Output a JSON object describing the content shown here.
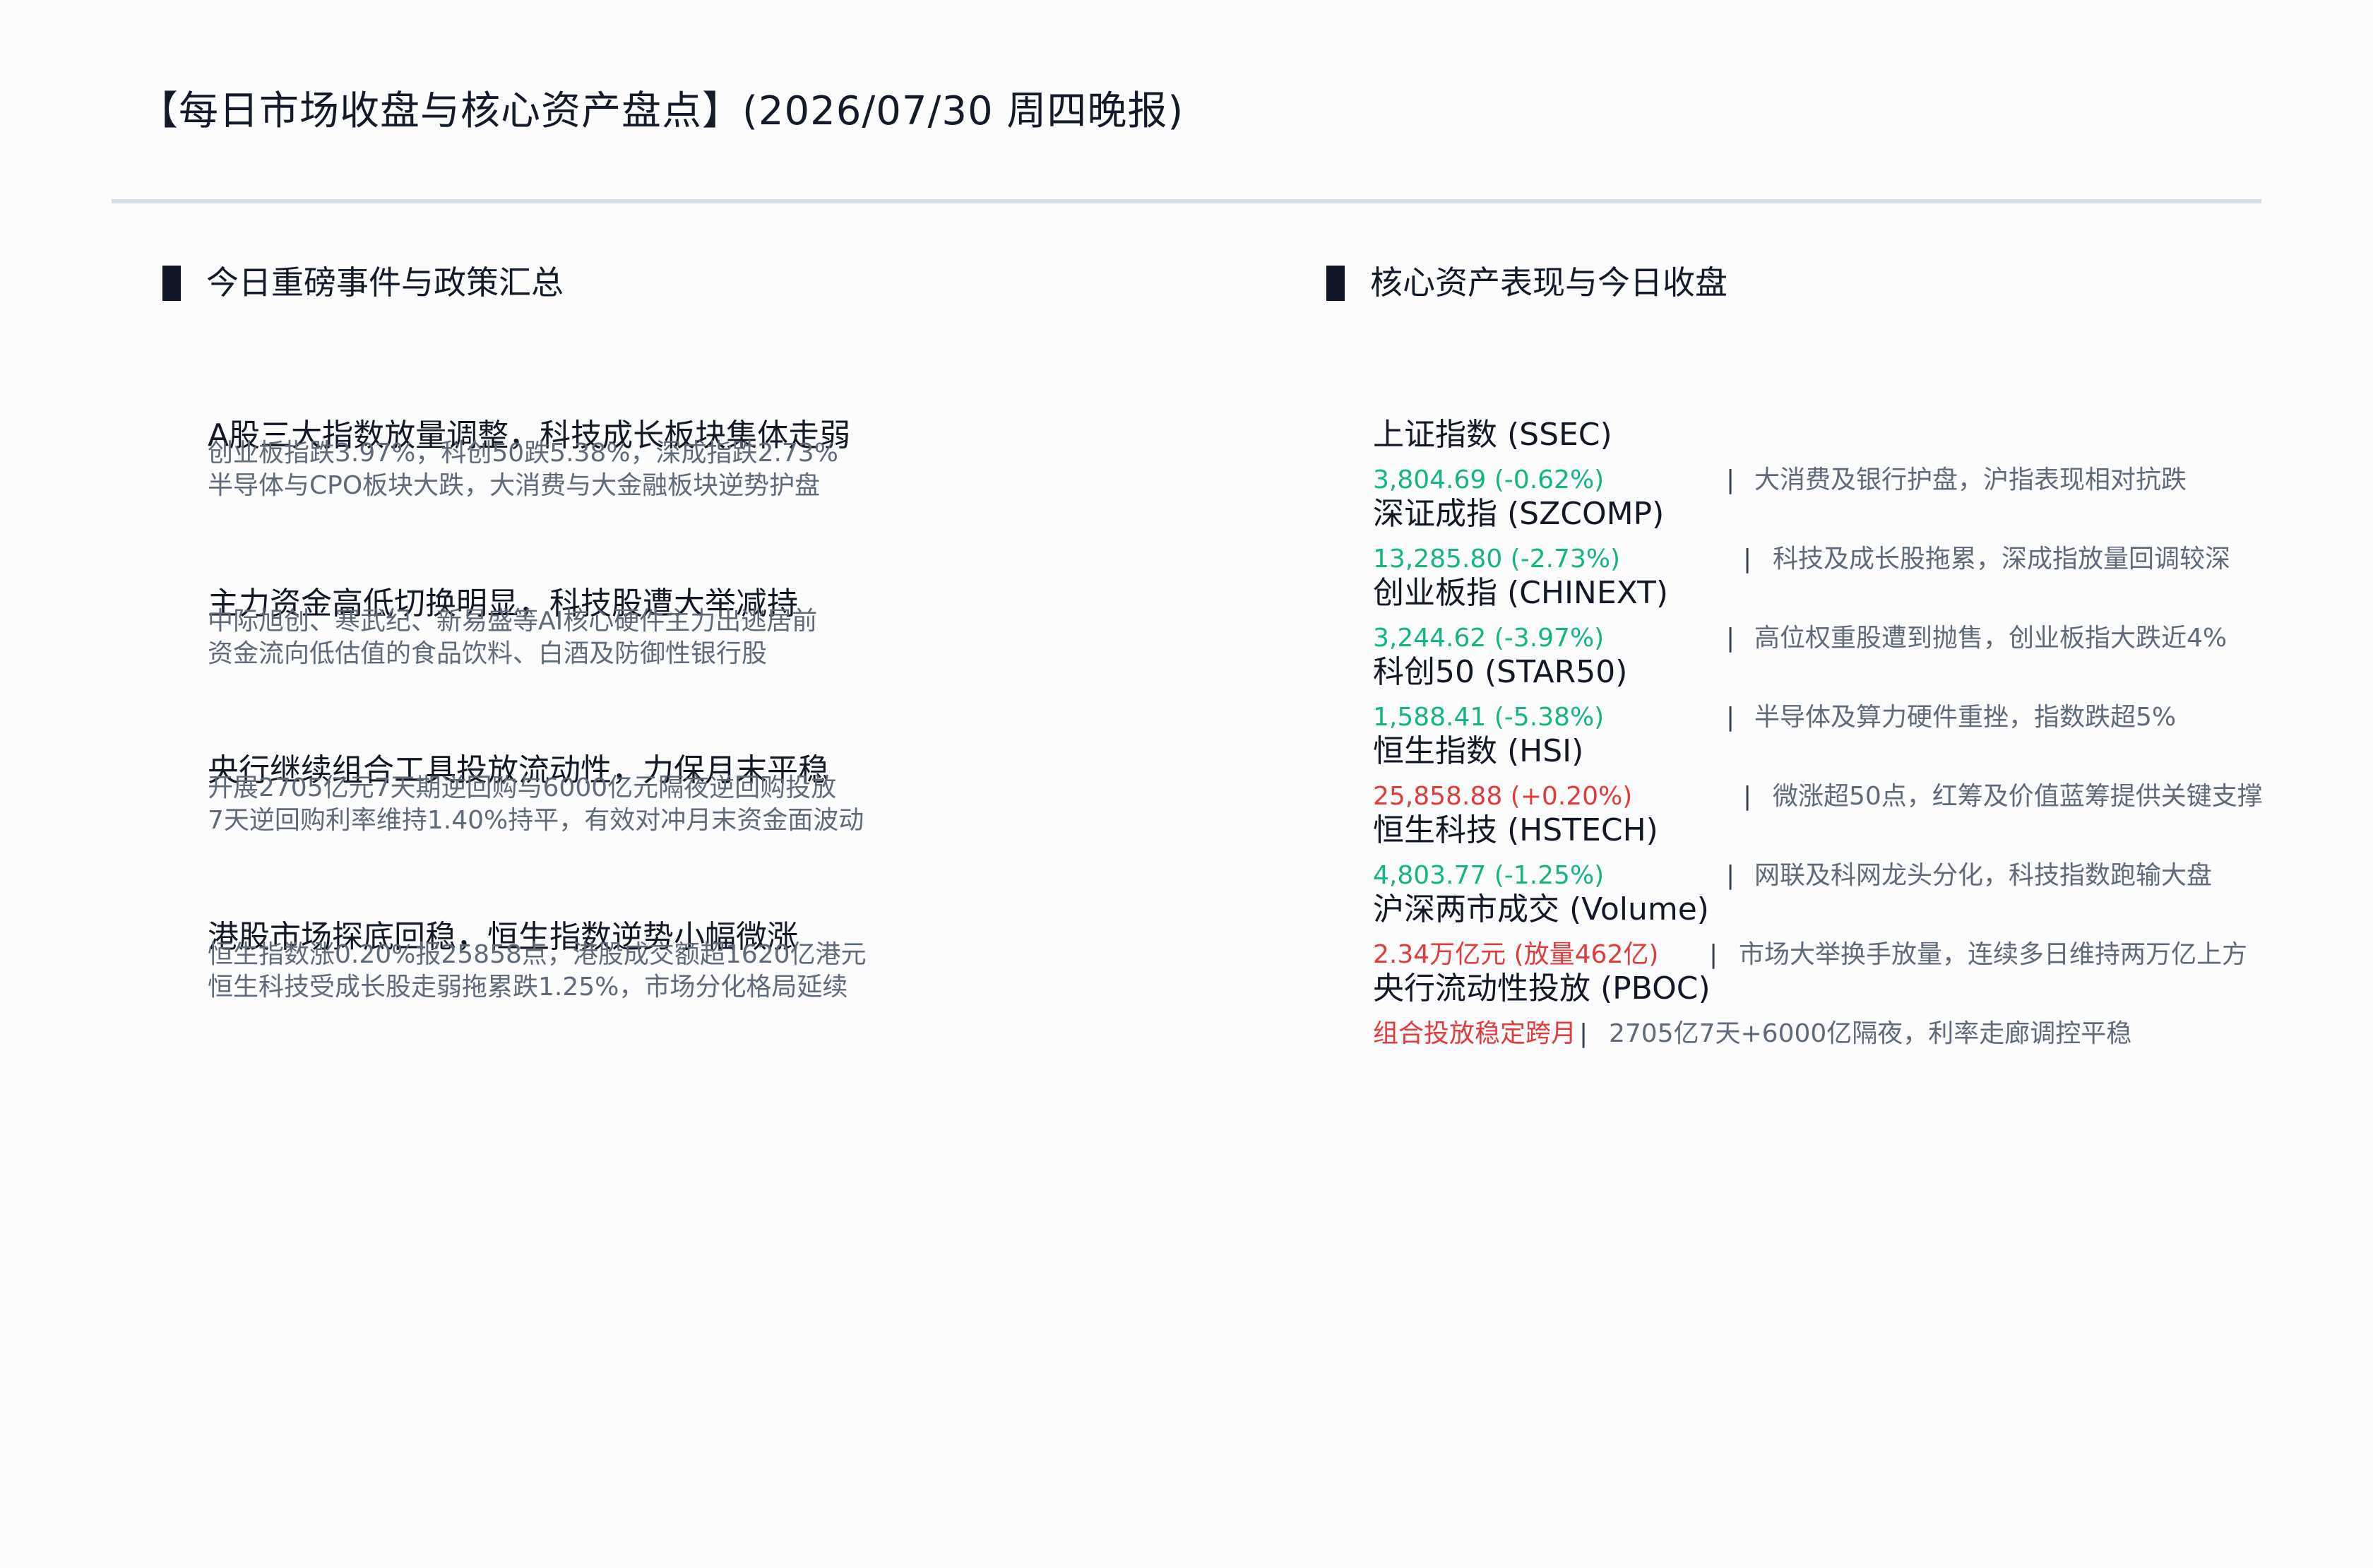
{
  "page_title": "【每日市场收盘与核心资产盘点】(2026/07/30 周四晚报)",
  "colors": {
    "up": "#e23b3b",
    "down": "#15b582",
    "policy": "#e23b3b"
  },
  "left_section": {
    "heading": "今日重磅事件与政策汇总",
    "events": [
      {
        "title": "A股三大指数放量调整，科技成长板块集体走弱",
        "line1": "创业板指跌3.97%，科创50跌5.38%，深成指跌2.73%",
        "line2": "半导体与CPO板块大跌，大消费与大金融板块逆势护盘"
      },
      {
        "title": "主力资金高低切换明显，科技股遭大举减持",
        "line1": "中际旭创、寒武纪、新易盛等AI核心硬件主力出逃居前",
        "line2": "资金流向低估值的食品饮料、白酒及防御性银行股"
      },
      {
        "title": "央行继续组合工具投放流动性，力保月末平稳",
        "line1": "开展2705亿元7天期逆回购与6000亿元隔夜逆回购投放",
        "line2": "7天逆回购利率维持1.40%持平，有效对冲月末资金面波动"
      },
      {
        "title": "港股市场探底回稳，恒生指数逆势小幅微涨",
        "line1": "恒生指数涨0.20%报25858点，港股成交额超1620亿港元",
        "line2": "恒生科技受成长股走弱拖累跌1.25%，市场分化格局延续"
      }
    ]
  },
  "right_section": {
    "heading": "核心资产表现与今日收盘",
    "separator": "|",
    "assets": [
      {
        "name": "上证指数 (SSEC)",
        "value": "3,804.69 (-0.62%)",
        "direction": "down",
        "note": "大消费及银行护盘，沪指表现相对抗跌"
      },
      {
        "name": "深证成指 (SZCOMP)",
        "value": "13,285.80 (-2.73%)",
        "direction": "down",
        "note": "科技及成长股拖累，深成指放量回调较深"
      },
      {
        "name": "创业板指 (CHINEXT)",
        "value": "3,244.62 (-3.97%)",
        "direction": "down",
        "note": "高位权重股遭到抛售，创业板指大跌近4%"
      },
      {
        "name": "科创50 (STAR50)",
        "value": "1,588.41 (-5.38%)",
        "direction": "down",
        "note": "半导体及算力硬件重挫，指数跌超5%"
      },
      {
        "name": "恒生指数 (HSI)",
        "value": "25,858.88 (+0.20%)",
        "direction": "up",
        "note": "微涨超50点，红筹及价值蓝筹提供关键支撑"
      },
      {
        "name": "恒生科技 (HSTECH)",
        "value": "4,803.77 (-1.25%)",
        "direction": "down",
        "note": "网联及科网龙头分化，科技指数跑输大盘"
      },
      {
        "name": "沪深两市成交 (Volume)",
        "value": "2.34万亿元 (放量462亿)",
        "direction": "up",
        "note": "市场大举换手放量，连续多日维持两万亿上方"
      },
      {
        "name": "央行流动性投放 (PBOC)",
        "value": "组合投放稳定跨月",
        "direction": "policy",
        "note": "2705亿7天+6000亿隔夜，利率走廊调控平稳"
      }
    ]
  }
}
